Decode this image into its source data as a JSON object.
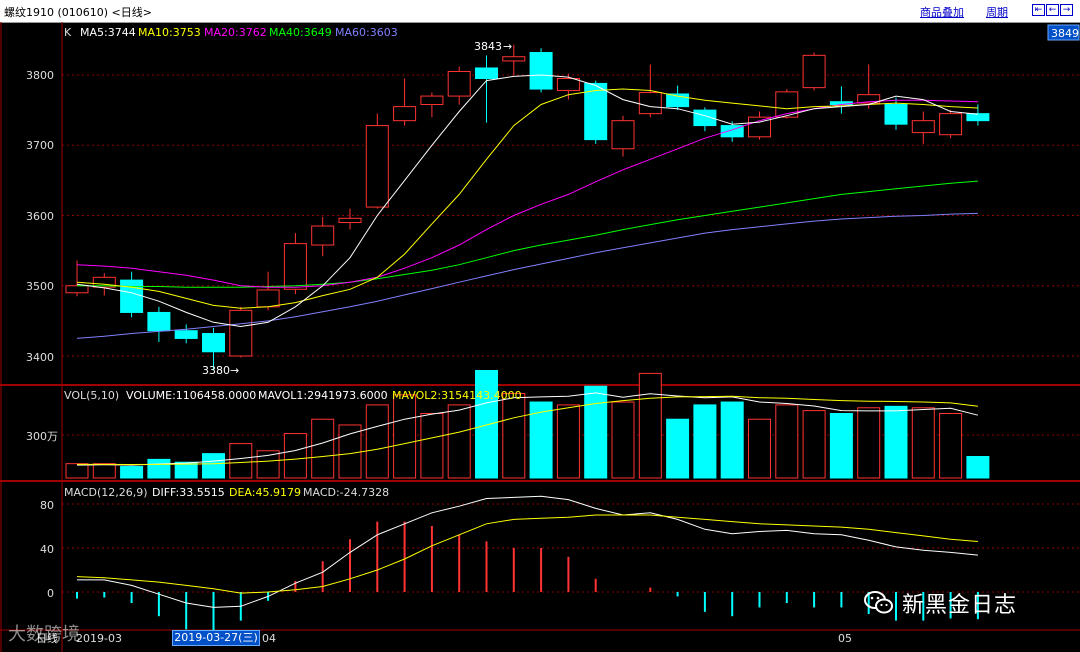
{
  "titlebar": {
    "title": "螺纹1910 (010610) <日线>",
    "link_overlay": "商品叠加",
    "link_period": "周期"
  },
  "price_panel": {
    "k_label": "K",
    "ma5": "MA5:3744",
    "ma10": "MA10:3753",
    "ma20": "MA20:3762",
    "ma40": "MA40:3649",
    "ma60": "MA60:3603",
    "price_tag": "3849",
    "high_label": "3843",
    "low_label": "3380",
    "ylim": [
      3340,
      3850
    ],
    "yticks": [
      "3800",
      "3700",
      "3600",
      "3500",
      "3400"
    ]
  },
  "volume_panel": {
    "label": "VOL(5,10)",
    "volume": "VOLUME:1106458.0000",
    "mavol1": "MAVOL1:2941973.6000",
    "mavol2": "MAVOL2:3154143.4000",
    "ytick": "300万"
  },
  "macd_panel": {
    "label": "MACD(12,26,9)",
    "diff": "DIFF:33.5515",
    "dea": "DEA:45.9179",
    "macd": "MACD:-24.7328",
    "yticks": [
      "80",
      "40",
      "0"
    ]
  },
  "axis": {
    "xlabels": [
      "日线",
      "2019-03",
      "04",
      "05"
    ],
    "selected_date": "2019-03-27(三)"
  },
  "watermark": {
    "logo": "大数跨境",
    "wechat_name": "新黑金日志"
  },
  "colors": {
    "up": "#ff3333",
    "down": "#00ffff",
    "ma5": "#ffffff",
    "ma10": "#ffff00",
    "ma20": "#ff00ff",
    "ma40": "#00ff00",
    "ma60": "#8080ff",
    "grid": "#8b0000",
    "frame": "#a00000"
  },
  "chart_data": {
    "type": "candlestick",
    "candles": [
      {
        "o": 3490,
        "c": 3500,
        "h": 3536,
        "l": 3485
      },
      {
        "o": 3498,
        "c": 3512,
        "h": 3518,
        "l": 3486
      },
      {
        "o": 3508,
        "c": 3462,
        "h": 3520,
        "l": 3455
      },
      {
        "o": 3462,
        "c": 3436,
        "h": 3470,
        "l": 3420
      },
      {
        "o": 3436,
        "c": 3425,
        "h": 3445,
        "l": 3418
      },
      {
        "o": 3432,
        "c": 3406,
        "h": 3440,
        "l": 3380
      },
      {
        "o": 3400,
        "c": 3465,
        "h": 3470,
        "l": 3398
      },
      {
        "o": 3470,
        "c": 3494,
        "h": 3520,
        "l": 3465
      },
      {
        "o": 3495,
        "c": 3560,
        "h": 3575,
        "l": 3488
      },
      {
        "o": 3558,
        "c": 3585,
        "h": 3598,
        "l": 3542
      },
      {
        "o": 3590,
        "c": 3596,
        "h": 3610,
        "l": 3580
      },
      {
        "o": 3612,
        "c": 3728,
        "h": 3745,
        "l": 3610
      },
      {
        "o": 3735,
        "c": 3755,
        "h": 3795,
        "l": 3728
      },
      {
        "o": 3758,
        "c": 3770,
        "h": 3775,
        "l": 3740
      },
      {
        "o": 3770,
        "c": 3805,
        "h": 3812,
        "l": 3758
      },
      {
        "o": 3810,
        "c": 3795,
        "h": 3828,
        "l": 3732
      },
      {
        "o": 3820,
        "c": 3826,
        "h": 3843,
        "l": 3800
      },
      {
        "o": 3832,
        "c": 3780,
        "h": 3838,
        "l": 3775
      },
      {
        "o": 3778,
        "c": 3795,
        "h": 3802,
        "l": 3765
      },
      {
        "o": 3788,
        "c": 3708,
        "h": 3792,
        "l": 3702
      },
      {
        "o": 3695,
        "c": 3735,
        "h": 3742,
        "l": 3684
      },
      {
        "o": 3745,
        "c": 3775,
        "h": 3815,
        "l": 3740
      },
      {
        "o": 3773,
        "c": 3755,
        "h": 3785,
        "l": 3750
      },
      {
        "o": 3750,
        "c": 3728,
        "h": 3754,
        "l": 3720
      },
      {
        "o": 3728,
        "c": 3712,
        "h": 3734,
        "l": 3705
      },
      {
        "o": 3712,
        "c": 3740,
        "h": 3748,
        "l": 3708
      },
      {
        "o": 3740,
        "c": 3776,
        "h": 3780,
        "l": 3738
      },
      {
        "o": 3782,
        "c": 3828,
        "h": 3832,
        "l": 3778
      },
      {
        "o": 3762,
        "c": 3758,
        "h": 3784,
        "l": 3745
      },
      {
        "o": 3760,
        "c": 3772,
        "h": 3815,
        "l": 3752
      },
      {
        "o": 3758,
        "c": 3730,
        "h": 3768,
        "l": 3722
      },
      {
        "o": 3718,
        "c": 3735,
        "h": 3748,
        "l": 3702
      },
      {
        "o": 3715,
        "c": 3745,
        "h": 3750,
        "l": 3710
      },
      {
        "o": 3745,
        "c": 3735,
        "h": 3758,
        "l": 3728
      }
    ],
    "ma5": [
      3502,
      3497,
      3490,
      3478,
      3462,
      3448,
      3442,
      3448,
      3470,
      3500,
      3540,
      3600,
      3650,
      3700,
      3748,
      3792,
      3798,
      3800,
      3797,
      3785,
      3765,
      3755,
      3752,
      3742,
      3730,
      3733,
      3742,
      3752,
      3755,
      3758,
      3770,
      3765,
      3748,
      3744
    ],
    "ma10": [
      3505,
      3502,
      3498,
      3492,
      3482,
      3472,
      3468,
      3470,
      3476,
      3486,
      3495,
      3512,
      3545,
      3588,
      3630,
      3680,
      3728,
      3758,
      3772,
      3778,
      3780,
      3778,
      3770,
      3764,
      3760,
      3756,
      3752,
      3755,
      3756,
      3758,
      3760,
      3758,
      3755,
      3753
    ],
    "ma20": [
      3530,
      3528,
      3525,
      3520,
      3515,
      3508,
      3500,
      3498,
      3498,
      3500,
      3505,
      3512,
      3525,
      3540,
      3558,
      3580,
      3600,
      3616,
      3630,
      3648,
      3665,
      3680,
      3695,
      3710,
      3722,
      3735,
      3745,
      3752,
      3758,
      3762,
      3764,
      3764,
      3763,
      3762
    ],
    "ma40": [
      3500,
      3500,
      3499,
      3499,
      3498,
      3498,
      3498,
      3499,
      3500,
      3502,
      3505,
      3510,
      3516,
      3522,
      3530,
      3540,
      3550,
      3558,
      3565,
      3572,
      3580,
      3587,
      3594,
      3600,
      3606,
      3612,
      3618,
      3624,
      3630,
      3634,
      3638,
      3642,
      3646,
      3649
    ],
    "ma60": [
      3425,
      3428,
      3432,
      3435,
      3438,
      3442,
      3446,
      3450,
      3456,
      3463,
      3470,
      3478,
      3487,
      3496,
      3505,
      3514,
      3523,
      3531,
      3539,
      3547,
      3554,
      3561,
      3568,
      3575,
      3580,
      3584,
      3588,
      3592,
      3595,
      3597,
      3599,
      3600,
      3602,
      3603
    ],
    "volume_scale_note": "volumes in units of 10k lots",
    "volume": [
      100,
      100,
      80,
      130,
      110,
      170,
      240,
      190,
      310,
      410,
      370,
      510,
      580,
      450,
      510,
      750,
      590,
      530,
      510,
      640,
      530,
      730,
      410,
      510,
      530,
      410,
      510,
      470,
      450,
      490,
      500,
      490,
      450,
      150
    ],
    "mavol1": [
      90,
      92,
      90,
      98,
      104,
      118,
      136,
      158,
      192,
      244,
      308,
      360,
      410,
      446,
      474,
      524,
      560,
      566,
      570,
      594,
      564,
      588,
      572,
      560,
      566,
      530,
      520,
      502,
      470,
      468,
      468,
      478,
      486,
      438
    ],
    "mavol2": [
      95,
      95,
      94,
      95,
      97,
      100,
      108,
      118,
      132,
      150,
      170,
      200,
      240,
      280,
      320,
      370,
      420,
      460,
      490,
      520,
      540,
      556,
      566,
      568,
      570,
      560,
      556,
      548,
      540,
      536,
      534,
      530,
      524,
      500
    ],
    "diff": [
      11,
      11,
      6,
      -2,
      -10,
      -14,
      -13,
      -4,
      8,
      18,
      36,
      52,
      62,
      72,
      78,
      85,
      86,
      87,
      84,
      76,
      70,
      72,
      66,
      57,
      53,
      55,
      56,
      53,
      52,
      47,
      41,
      38,
      36,
      33.55
    ],
    "dea": [
      14,
      13,
      11,
      9,
      6,
      3,
      -1,
      0,
      2,
      5,
      12,
      20,
      30,
      42,
      52,
      62,
      66,
      67,
      68,
      70,
      70,
      70,
      68,
      66,
      64,
      62,
      61,
      60,
      59,
      57,
      54,
      51,
      48,
      45.92
    ],
    "macd": [
      -6,
      -5,
      -10,
      -22,
      -34,
      -36,
      -26,
      -8,
      10,
      28,
      48,
      64,
      64,
      60,
      52,
      46,
      40,
      40,
      32,
      12,
      0,
      4,
      -4,
      -18,
      -22,
      -14,
      -10,
      -14,
      -14,
      -20,
      -26,
      -26,
      -24,
      -24.73
    ]
  }
}
